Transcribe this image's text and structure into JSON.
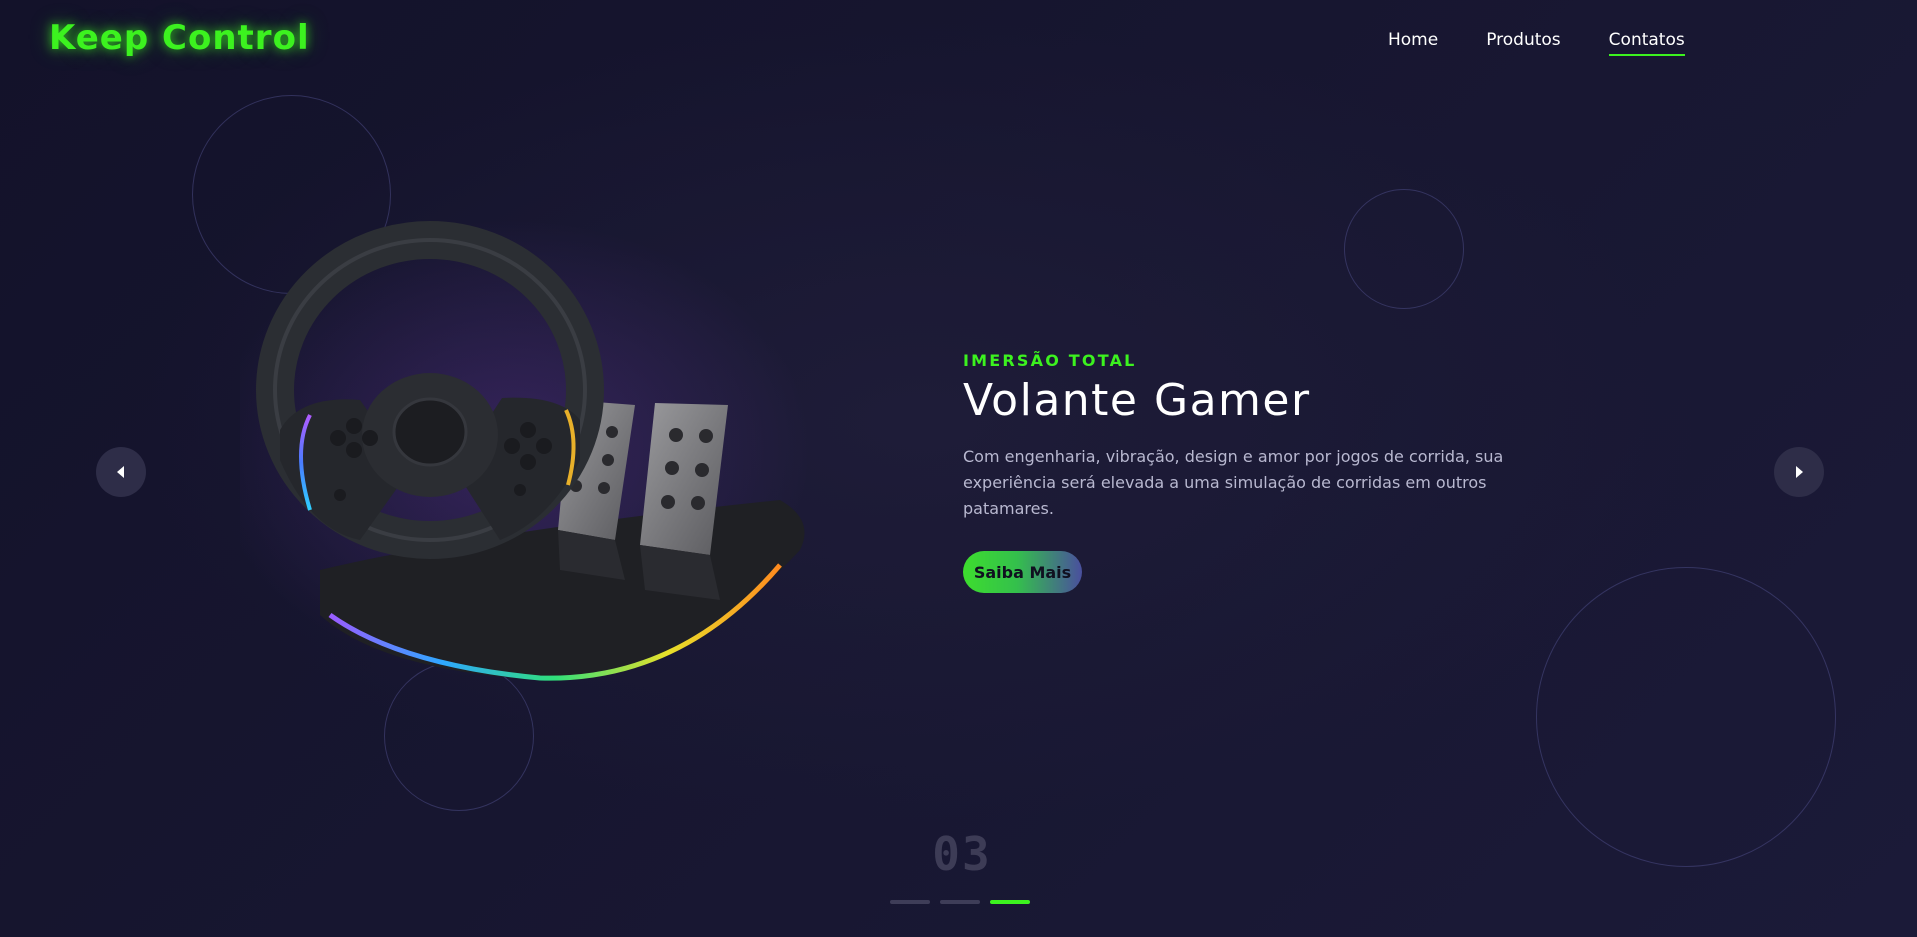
{
  "header": {
    "logo": "Keep Control",
    "nav": [
      {
        "label": "Home",
        "active": false
      },
      {
        "label": "Produtos",
        "active": false
      },
      {
        "label": "Contatos",
        "active": true
      }
    ]
  },
  "slide": {
    "eyebrow": "IMERSÃO TOTAL",
    "title": "Volante Gamer",
    "description": "Com engenharia, vibração, design e amor por jogos de corrida, sua experiência será elevada a uma simulação de corridas em outros patamares.",
    "cta_label": "Saiba Mais",
    "counter": "03",
    "product_image": "racing-wheel-and-pedals"
  },
  "carousel": {
    "prev_icon": "caret-left-icon",
    "next_icon": "caret-right-icon",
    "total_slides": 3,
    "active_index": 3
  },
  "colors": {
    "accent": "#3cf21f",
    "background": "#15142a",
    "muted": "#3d3c56",
    "text": "#ffffff",
    "body_text": "#b8b8d0"
  }
}
